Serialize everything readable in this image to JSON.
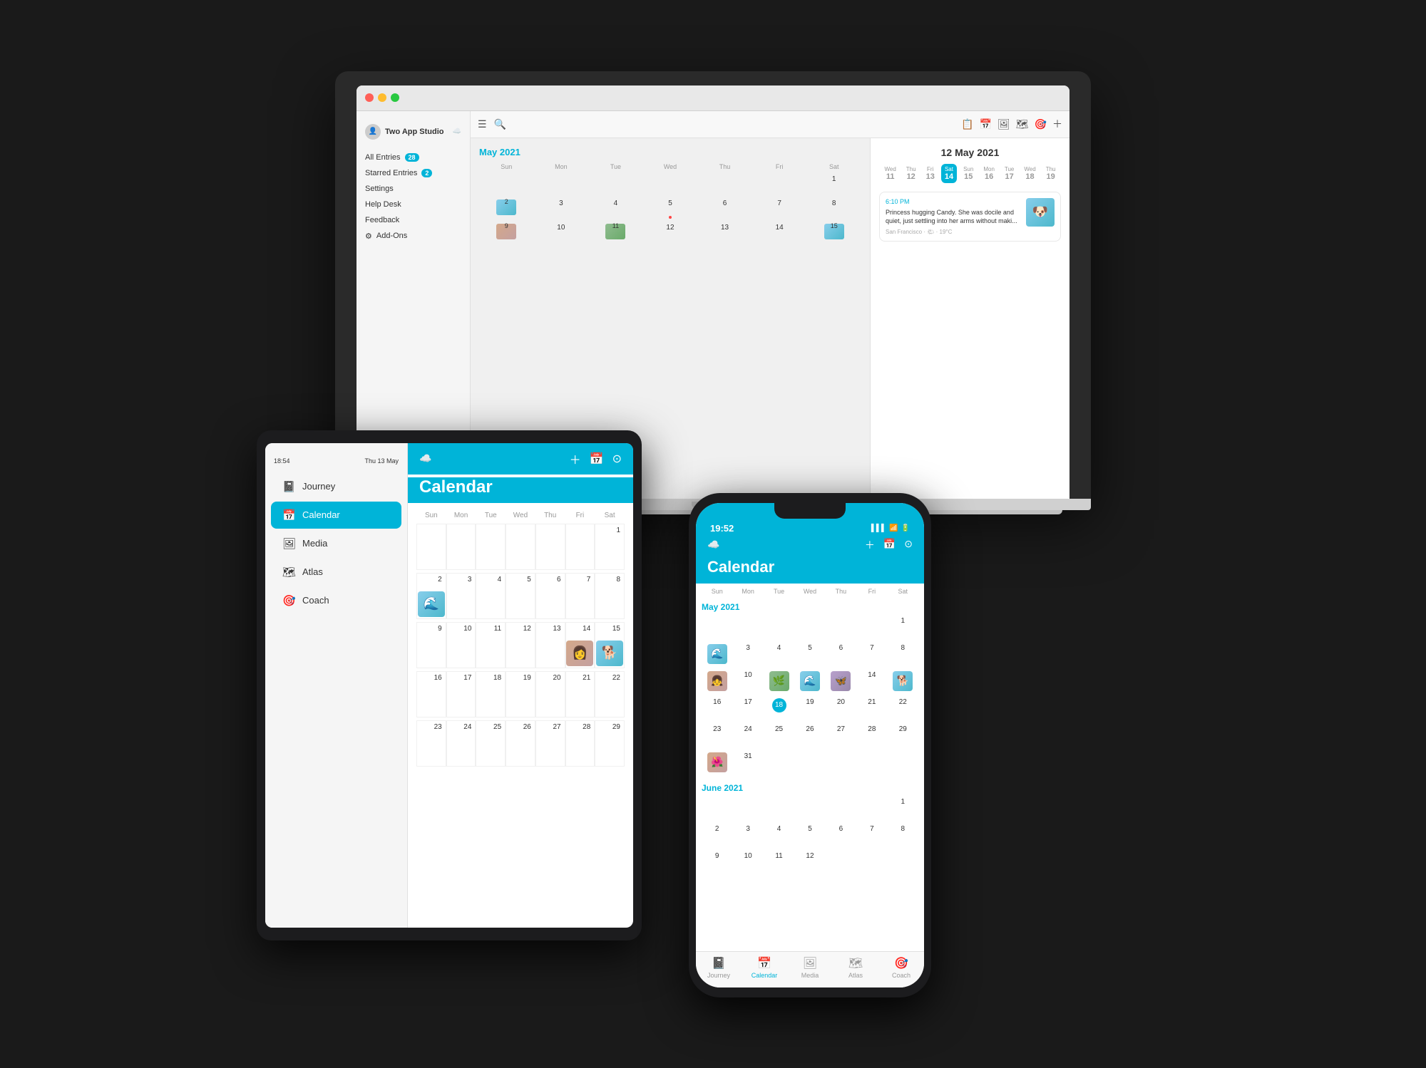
{
  "laptop": {
    "sidebar": {
      "username": "Two App Studio",
      "nav_items": [
        {
          "label": "All Entries",
          "badge": "28"
        },
        {
          "label": "Starred Entries",
          "badge": "2"
        },
        {
          "label": "Settings",
          "badge": null
        },
        {
          "label": "Help Desk",
          "badge": null
        },
        {
          "label": "Feedback",
          "badge": null
        },
        {
          "label": "Add-Ons",
          "badge": null
        }
      ]
    },
    "calendar": {
      "month_label": "May 2021",
      "date_title": "12 May 2021",
      "day_names": [
        "Sun",
        "Mon",
        "Tue",
        "Wed",
        "Thu",
        "Fri",
        "Sat"
      ],
      "entry_time": "6:10 PM",
      "entry_text": "Princess hugging Candy. She was docile and quiet, just settling into her arms without maki...",
      "entry_location": "San Francisco · 🌤 · 19°C",
      "week_days": [
        {
          "label": "Wed",
          "num": "11"
        },
        {
          "label": "Thu",
          "num": "12"
        },
        {
          "label": "Fri",
          "num": "13"
        },
        {
          "label": "Sat",
          "num": "14",
          "active": true
        },
        {
          "label": "Sun",
          "num": "15"
        },
        {
          "label": "Mon",
          "num": "16"
        },
        {
          "label": "Tue",
          "num": "17"
        },
        {
          "label": "Wed",
          "num": "18"
        },
        {
          "label": "Thu",
          "num": "19"
        }
      ]
    }
  },
  "tablet": {
    "status_bar": {
      "time": "18:54",
      "date": "Thu 13 May"
    },
    "nav_items": [
      {
        "label": "Journey",
        "icon": "📓",
        "active": false
      },
      {
        "label": "Calendar",
        "icon": "📅",
        "active": true
      },
      {
        "label": "Media",
        "icon": "🖼",
        "active": false
      },
      {
        "label": "Atlas",
        "icon": "🗺",
        "active": false
      },
      {
        "label": "Coach",
        "icon": "🎯",
        "active": false
      }
    ],
    "header_title": "Calendar",
    "day_names": [
      "Sun",
      "Mon",
      "Tue",
      "Wed",
      "Thu",
      "Fri",
      "Sat"
    ]
  },
  "phone": {
    "status_bar": {
      "time": "19:52"
    },
    "header_title": "Calendar",
    "day_names": [
      "Sun",
      "Mon",
      "Tue",
      "Wed",
      "Thu",
      "Fri",
      "Sat"
    ],
    "month1": "May 2021",
    "month2": "June 2021",
    "tab_items": [
      {
        "label": "Journey",
        "icon": "📓",
        "active": false
      },
      {
        "label": "Calendar",
        "icon": "📅",
        "active": true
      },
      {
        "label": "Media",
        "icon": "🖼",
        "active": false
      },
      {
        "label": "Atlas",
        "icon": "🗺",
        "active": false
      },
      {
        "label": "Coach",
        "icon": "🎯",
        "active": false
      }
    ]
  }
}
